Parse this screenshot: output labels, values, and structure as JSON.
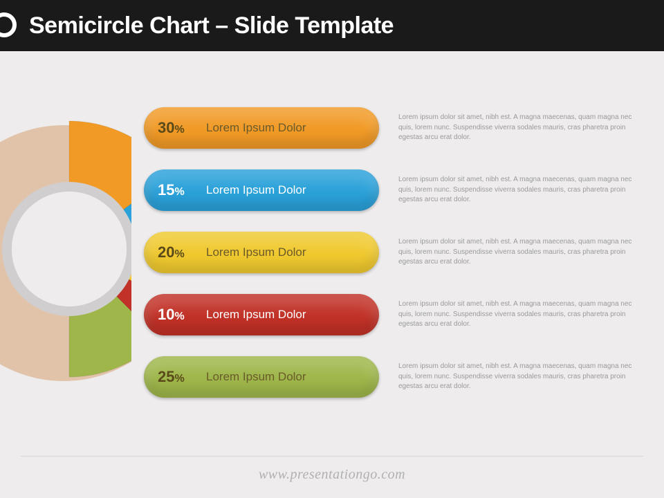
{
  "title": "Semicircle Chart – Slide Template",
  "footer": "www.presentationgo.com",
  "desc_text": "Lorem ipsum dolor sit amet, nibh est. A magna maecenas, quam magna nec quis, lorem nunc. Suspendisse viverra sodales mauris, cras pharetra proin egestas arcu erat dolor.",
  "chart_data": {
    "type": "pie",
    "title": "Semicircle Chart",
    "series": [
      {
        "label": "Lorem Ipsum Dolor",
        "percent": 30,
        "color": "#f19a26",
        "text_dark": true
      },
      {
        "label": "Lorem Ipsum Dolor",
        "percent": 15,
        "color": "#2aa1d9",
        "text_dark": false
      },
      {
        "label": "Lorem Ipsum Dolor",
        "percent": 20,
        "color": "#f0c92f",
        "text_dark": true
      },
      {
        "label": "Lorem Ipsum Dolor",
        "percent": 10,
        "color": "#c13127",
        "text_dark": false
      },
      {
        "label": "Lorem Ipsum Dolor",
        "percent": 25,
        "color": "#9eb64a",
        "text_dark": true
      }
    ]
  }
}
